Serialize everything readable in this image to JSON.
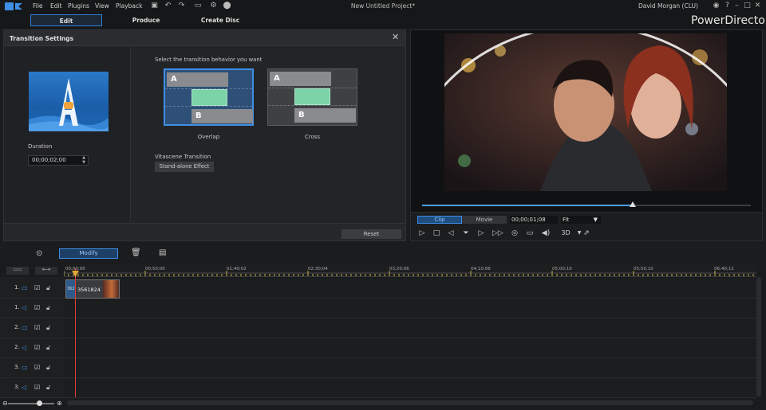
{
  "menu": [
    "File",
    "Edit",
    "Plugins",
    "View",
    "Playback"
  ],
  "project_title": "New Untitled Project*",
  "user": "David Morgan (CLU)",
  "brand": "PowerDirector",
  "tabs": [
    "Edit",
    "Produce",
    "Create Disc"
  ],
  "transition": {
    "title": "Transition Settings",
    "select_label": "Select the transition behavior you want",
    "duration_label": "Duration",
    "duration_value": "00;00;02;00",
    "overlap_label": "Overlap",
    "cross_label": "Cross",
    "a_label": "A",
    "b_label": "B",
    "vitascene_label": "Vitascene Transition",
    "standalone_label": "Stand-alone Effect",
    "reset_label": "Reset"
  },
  "preview": {
    "clip_label": "Clip",
    "movie_label": "Movie",
    "timecode": "00;00;01;08",
    "fit_label": "Fit",
    "three_d_label": "3D",
    "scrub_fraction": 0.64
  },
  "toolbar": {
    "modify_label": "Modify"
  },
  "timeline": {
    "ruler_labels": [
      "00;00;00",
      "00;50;00",
      "01;40;02",
      "02;30;04",
      "03;20;06",
      "04;10;08",
      "05;00;10",
      "05;50;10",
      "06;40;12"
    ],
    "tracks": [
      {
        "num": "1.",
        "kind": "video"
      },
      {
        "num": "1.",
        "kind": "audio"
      },
      {
        "num": "2.",
        "kind": "video"
      },
      {
        "num": "2.",
        "kind": "audio"
      },
      {
        "num": "3.",
        "kind": "video"
      },
      {
        "num": "3.",
        "kind": "audio"
      }
    ],
    "clip_label": "3561824",
    "clip_label_small": "362"
  },
  "colors": {
    "accent": "#3e8fe6",
    "playhead": "#e23b3b",
    "green": "#7cd3a8"
  },
  "icons": [
    "app-logo-icon",
    "save-icon",
    "undo-icon",
    "redo-icon",
    "gear-icon",
    "lock-icon",
    "account-icon",
    "help-icon",
    "minimize-icon",
    "maximize-icon",
    "close-icon",
    "play-icon",
    "stop-icon",
    "prev-frame-icon",
    "next-frame-icon",
    "fast-forward-icon",
    "snapshot-icon",
    "volume-icon",
    "trash-icon"
  ]
}
